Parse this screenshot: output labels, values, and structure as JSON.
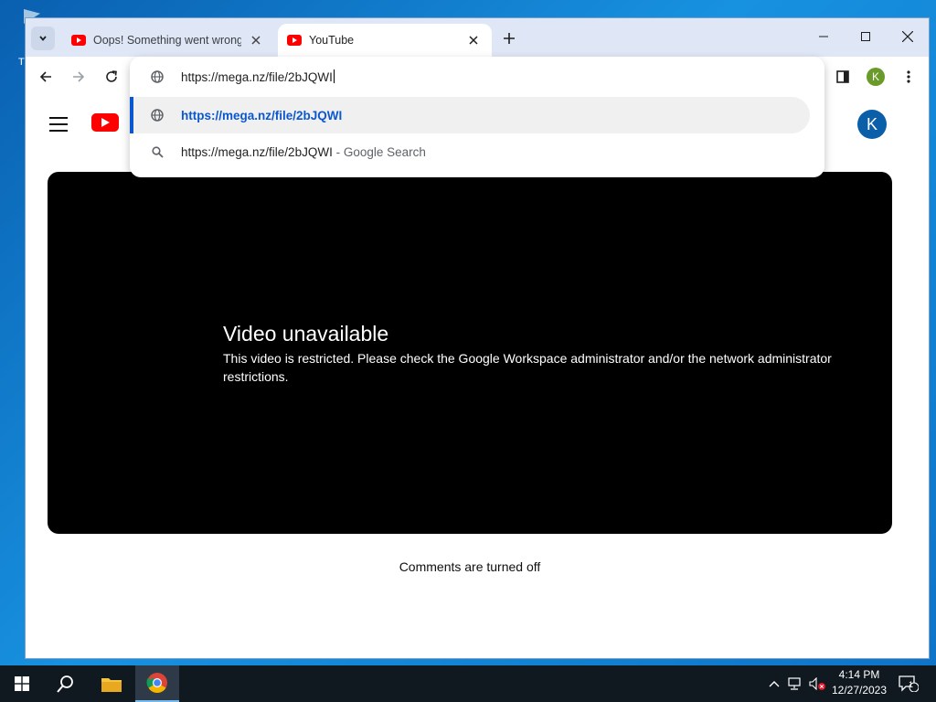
{
  "desktop": {
    "icon_label": "Tr"
  },
  "browser": {
    "tabs": [
      {
        "title": "Oops! Something went wrong.",
        "active": false
      },
      {
        "title": "YouTube",
        "active": true
      }
    ],
    "profile_initial": "K"
  },
  "omnibox": {
    "input_value": "https://mega.nz/file/2bJQWI",
    "suggestions": [
      {
        "text": "https://mega.nz/file/2bJQWI",
        "type": "url",
        "selected": true
      },
      {
        "text": "https://mega.nz/file/2bJQWI",
        "suffix": " - Google Search",
        "type": "search",
        "selected": false
      }
    ]
  },
  "youtube": {
    "avatar_initial": "K",
    "player": {
      "title": "Video unavailable",
      "message": "This video is restricted. Please check the Google Workspace administrator and/or the network administrator restrictions."
    },
    "comments_text": "Comments are turned off"
  },
  "taskbar": {
    "time": "4:14 PM",
    "date": "12/27/2023",
    "notification_count": "1"
  },
  "colors": {
    "accent": "#0b57d0",
    "youtube_red": "#ff0000",
    "taskbar": "#101820"
  }
}
